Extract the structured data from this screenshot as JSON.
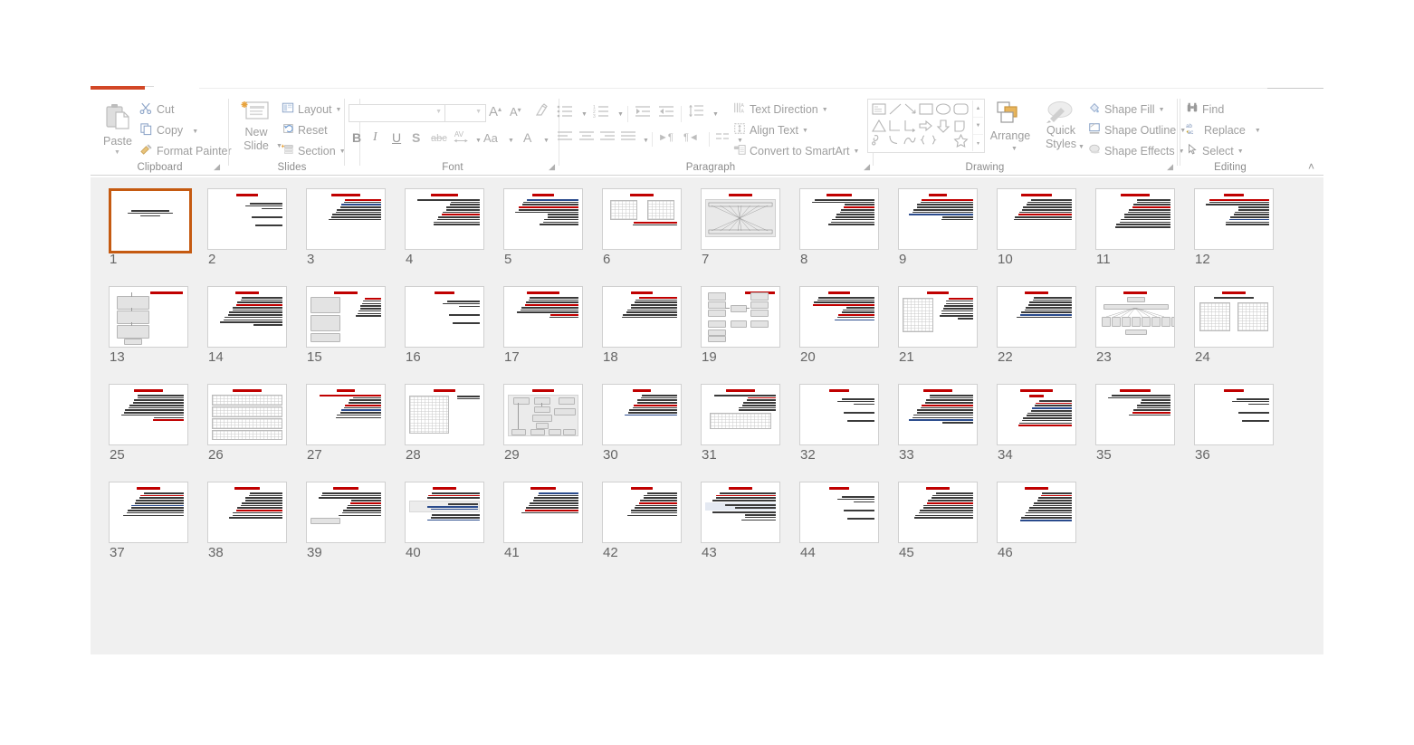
{
  "app": {
    "name": "PowerPoint",
    "view": "Slide Sorter",
    "accent_color": "#d24726",
    "selection_color": "#c55a11",
    "ribbon_background": "#ffffff",
    "sorter_background": "#f0f0f0"
  },
  "ribbon": {
    "collapse_caret": "˄",
    "groups": [
      {
        "id": "clipboard",
        "label": "Clipboard",
        "has_launcher": true,
        "launcher_glyph": "⬌",
        "items": [
          {
            "label": "Paste",
            "icon": "paste-icon",
            "has_caret": true
          },
          {
            "label": "Cut",
            "icon": "scissors-icon",
            "has_caret": false
          },
          {
            "label": "Copy",
            "icon": "copy-icon",
            "has_caret": true
          },
          {
            "label": "Format Painter",
            "icon": "format-painter-icon",
            "has_caret": false
          }
        ]
      },
      {
        "id": "slides",
        "label": "Slides",
        "has_launcher": false,
        "items": [
          {
            "label": "New\nSlide",
            "label_line1": "New",
            "label_line2": "Slide",
            "icon": "new-slide-icon",
            "has_caret": true
          },
          {
            "label": "Layout",
            "icon": "layout-icon",
            "has_caret": true
          },
          {
            "label": "Reset",
            "icon": "reset-icon",
            "has_caret": false
          },
          {
            "label": "Section",
            "icon": "section-icon",
            "has_caret": true
          }
        ]
      },
      {
        "id": "font",
        "label": "Font",
        "has_launcher": true,
        "launcher_glyph": "⬌",
        "font_name_value": "",
        "font_name_placeholder": "",
        "font_size_value": "",
        "font_size_placeholder": "",
        "items": [
          {
            "label": "A˄",
            "icon": "increase-font-size-icon"
          },
          {
            "label": "A˅",
            "icon": "decrease-font-size-icon"
          },
          {
            "label": "",
            "icon": "clear-formatting-icon"
          },
          {
            "label": "B",
            "icon": "bold-icon"
          },
          {
            "label": "I",
            "icon": "italic-icon"
          },
          {
            "label": "U",
            "icon": "underline-icon"
          },
          {
            "label": "S",
            "icon": "text-shadow-icon"
          },
          {
            "label": "abc",
            "icon": "strikethrough-icon"
          },
          {
            "label": "AV",
            "icon": "character-spacing-icon",
            "has_caret": true
          },
          {
            "label": "Aa",
            "icon": "change-case-icon",
            "has_caret": true
          },
          {
            "label": "A",
            "icon": "font-color-icon",
            "has_caret": true
          }
        ]
      },
      {
        "id": "paragraph",
        "label": "Paragraph",
        "has_launcher": true,
        "launcher_glyph": "⬌",
        "items": [
          {
            "label": "",
            "icon": "bullets-icon",
            "has_caret": true
          },
          {
            "label": "",
            "icon": "numbering-icon",
            "has_caret": true
          },
          {
            "label": "",
            "icon": "decrease-indent-icon"
          },
          {
            "label": "",
            "icon": "increase-indent-icon"
          },
          {
            "label": "",
            "icon": "line-spacing-icon",
            "has_caret": true
          },
          {
            "label": "",
            "icon": "align-left-icon"
          },
          {
            "label": "",
            "icon": "align-center-icon"
          },
          {
            "label": "",
            "icon": "align-right-icon"
          },
          {
            "label": "",
            "icon": "justify-icon",
            "has_caret": true
          },
          {
            "label": "",
            "icon": "ltr-text-direction-icon"
          },
          {
            "label": "",
            "icon": "rtl-text-direction-icon"
          },
          {
            "label": "",
            "icon": "columns-icon",
            "has_caret": true
          },
          {
            "label": "Text Direction",
            "icon": "text-direction-icon",
            "has_caret": true
          },
          {
            "label": "Align Text",
            "icon": "align-text-icon",
            "has_caret": true
          },
          {
            "label": "Convert to SmartArt",
            "icon": "smartart-icon",
            "has_caret": true
          }
        ]
      },
      {
        "id": "drawing",
        "label": "Drawing",
        "has_launcher": true,
        "launcher_glyph": "⬌",
        "gallery_scroll": {
          "up": "▲",
          "down": "▼",
          "more": "▾"
        },
        "items": [
          {
            "label": "Arrange",
            "icon": "arrange-icon",
            "has_caret": true
          },
          {
            "label": "Quick\nStyles",
            "label_line1": "Quick",
            "label_line2": "Styles",
            "icon": "quick-styles-icon",
            "has_caret": true
          },
          {
            "label": "Shape Fill",
            "icon": "shape-fill-icon",
            "has_caret": true
          },
          {
            "label": "Shape Outline",
            "icon": "shape-outline-icon",
            "has_caret": true
          },
          {
            "label": "Shape Effects",
            "icon": "shape-effects-icon",
            "has_caret": true
          }
        ]
      },
      {
        "id": "editing",
        "label": "Editing",
        "has_launcher": false,
        "items": [
          {
            "label": "Find",
            "icon": "binoculars-icon",
            "has_caret": false
          },
          {
            "label": "Replace",
            "icon": "replace-icon",
            "has_caret": true
          },
          {
            "label": "Select",
            "icon": "select-pointer-icon",
            "has_caret": true
          }
        ]
      }
    ]
  },
  "slide_sorter": {
    "total_slides": 46,
    "selected_slide": 1,
    "columns": 12,
    "rows": 4,
    "slides": [
      {
        "n": "1",
        "kind": "title",
        "title_w": 0,
        "lines": 3
      },
      {
        "n": "2",
        "kind": "agenda",
        "title_w": 30,
        "lines": 6
      },
      {
        "n": "3",
        "kind": "text",
        "title_w": 40,
        "lines": 9
      },
      {
        "n": "4",
        "kind": "text",
        "title_w": 38,
        "lines": 11
      },
      {
        "n": "5",
        "kind": "text",
        "title_w": 30,
        "lines": 11
      },
      {
        "n": "6",
        "kind": "table2",
        "title_w": 34,
        "lines": 3
      },
      {
        "n": "7",
        "kind": "network",
        "title_w": 34,
        "lines": 2
      },
      {
        "n": "8",
        "kind": "text",
        "title_w": 36,
        "lines": 11
      },
      {
        "n": "9",
        "kind": "text",
        "title_w": 26,
        "lines": 9
      },
      {
        "n": "10",
        "kind": "text",
        "title_w": 44,
        "lines": 9
      },
      {
        "n": "11",
        "kind": "text",
        "title_w": 42,
        "lines": 12
      },
      {
        "n": "12",
        "kind": "text",
        "title_w": 28,
        "lines": 11
      },
      {
        "n": "13",
        "kind": "blockdiag",
        "title_w": 32,
        "lines": 0
      },
      {
        "n": "14",
        "kind": "text",
        "title_w": 34,
        "lines": 12
      },
      {
        "n": "15",
        "kind": "twopanel",
        "title_w": 34,
        "lines": 8
      },
      {
        "n": "16",
        "kind": "agenda",
        "title_w": 28,
        "lines": 6
      },
      {
        "n": "17",
        "kind": "text",
        "title_w": 46,
        "lines": 9
      },
      {
        "n": "18",
        "kind": "text",
        "title_w": 30,
        "lines": 9
      },
      {
        "n": "19",
        "kind": "flow",
        "title_w": 30,
        "lines": 0
      },
      {
        "n": "20",
        "kind": "text",
        "title_w": 32,
        "lines": 10
      },
      {
        "n": "21",
        "kind": "gridtext",
        "title_w": 30,
        "lines": 9
      },
      {
        "n": "22",
        "kind": "text",
        "title_w": 34,
        "lines": 9
      },
      {
        "n": "23",
        "kind": "fan",
        "title_w": 34,
        "lines": 0
      },
      {
        "n": "24",
        "kind": "twogrid",
        "title_w": 34,
        "lines": 1
      },
      {
        "n": "25",
        "kind": "text",
        "title_w": 40,
        "lines": 11
      },
      {
        "n": "26",
        "kind": "bigtable",
        "title_w": 40,
        "lines": 0
      },
      {
        "n": "27",
        "kind": "text",
        "title_w": 26,
        "lines": 10
      },
      {
        "n": "28",
        "kind": "tabletext",
        "title_w": 30,
        "lines": 2
      },
      {
        "n": "29",
        "kind": "flow2",
        "title_w": 30,
        "lines": 0
      },
      {
        "n": "30",
        "kind": "text",
        "title_w": 26,
        "lines": 9
      },
      {
        "n": "31",
        "kind": "tablebot",
        "title_w": 40,
        "lines": 7
      },
      {
        "n": "32",
        "kind": "agenda",
        "title_w": 28,
        "lines": 6
      },
      {
        "n": "33",
        "kind": "text",
        "title_w": 40,
        "lines": 12
      },
      {
        "n": "34",
        "kind": "text2ln",
        "title_w": 46,
        "lines": 11
      },
      {
        "n": "35",
        "kind": "text",
        "title_w": 44,
        "lines": 9
      },
      {
        "n": "36",
        "kind": "agenda",
        "title_w": 28,
        "lines": 6
      },
      {
        "n": "37",
        "kind": "text",
        "title_w": 34,
        "lines": 10
      },
      {
        "n": "38",
        "kind": "text",
        "title_w": 36,
        "lines": 11
      },
      {
        "n": "39",
        "kind": "textimg",
        "title_w": 36,
        "lines": 10
      },
      {
        "n": "40",
        "kind": "codebox",
        "title_w": 34,
        "lines": 9
      },
      {
        "n": "41",
        "kind": "text",
        "title_w": 36,
        "lines": 9
      },
      {
        "n": "42",
        "kind": "text",
        "title_w": 30,
        "lines": 10
      },
      {
        "n": "43",
        "kind": "texthl",
        "title_w": 34,
        "lines": 10
      },
      {
        "n": "44",
        "kind": "agenda",
        "title_w": 28,
        "lines": 6
      },
      {
        "n": "45",
        "kind": "text",
        "title_w": 34,
        "lines": 11
      },
      {
        "n": "46",
        "kind": "text",
        "title_w": 34,
        "lines": 12
      }
    ]
  }
}
